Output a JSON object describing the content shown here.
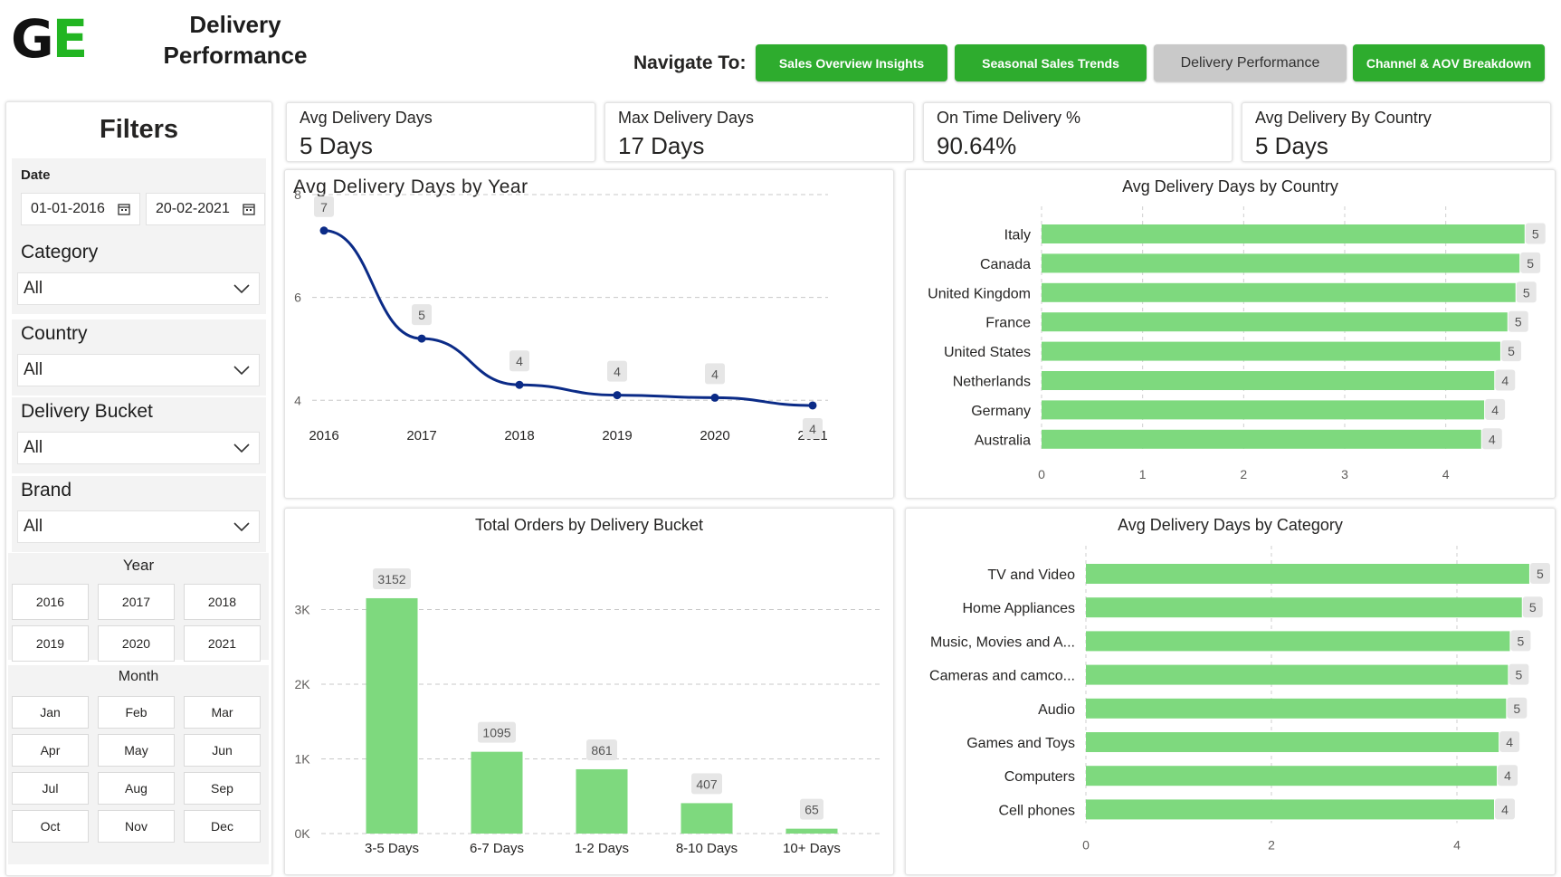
{
  "header": {
    "logo_g": "G",
    "logo_e": "E",
    "title_line1": "Delivery",
    "title_line2": "Performance",
    "navigate_label": "Navigate To:",
    "nav": [
      {
        "label": "Sales Overview Insights",
        "active": false
      },
      {
        "label": "Seasonal Sales Trends",
        "active": false
      },
      {
        "label": "Delivery Performance",
        "active": true
      },
      {
        "label": "Channel & AOV Breakdown",
        "active": false
      }
    ]
  },
  "filters": {
    "title": "Filters",
    "date_label": "Date",
    "date_from": "01-01-2016",
    "date_to": "20-02-2021",
    "category_label": "Category",
    "category_value": "All",
    "country_label": "Country",
    "country_value": "All",
    "bucket_label": "Delivery Bucket",
    "bucket_value": "All",
    "brand_label": "Brand",
    "brand_value": "All",
    "year_label": "Year",
    "years": [
      "2016",
      "2017",
      "2018",
      "2019",
      "2020",
      "2021"
    ],
    "month_label": "Month",
    "months": [
      "Jan",
      "Feb",
      "Mar",
      "Apr",
      "May",
      "Jun",
      "Jul",
      "Aug",
      "Sep",
      "Oct",
      "Nov",
      "Dec"
    ]
  },
  "kpis": [
    {
      "label": "Avg Delivery Days",
      "value": "5 Days"
    },
    {
      "label": "Max Delivery Days",
      "value": "17 Days"
    },
    {
      "label": "On Time Delivery %",
      "value": "90.64%"
    },
    {
      "label": "Avg Delivery By Country",
      "value": "5 Days"
    }
  ],
  "colors": {
    "bar": "#7ed97e",
    "line": "#0b2b87",
    "nav_green": "#2eac2e",
    "nav_active": "#c9c9c9"
  },
  "chart_data": [
    {
      "type": "line",
      "title": "Avg Delivery Days by Year",
      "x": [
        "2016",
        "2017",
        "2018",
        "2019",
        "2020",
        "2021"
      ],
      "values": [
        7.3,
        5.2,
        4.3,
        4.1,
        4.05,
        3.9
      ],
      "data_labels": [
        "7",
        "5",
        "4",
        "4",
        "4",
        "4"
      ],
      "yticks": [
        "4",
        "6",
        "8"
      ],
      "ylim": [
        3.6,
        8
      ],
      "grid": true
    },
    {
      "type": "bar",
      "orientation": "horizontal",
      "title": "Avg Delivery Days by Country",
      "categories": [
        "Italy",
        "Canada",
        "United Kingdom",
        "France",
        "United States",
        "Netherlands",
        "Germany",
        "Australia"
      ],
      "values": [
        4.78,
        4.73,
        4.69,
        4.61,
        4.54,
        4.48,
        4.38,
        4.35
      ],
      "data_labels": [
        "5",
        "5",
        "5",
        "5",
        "5",
        "4",
        "4",
        "4"
      ],
      "xticks": [
        "0",
        "1",
        "2",
        "3",
        "4"
      ],
      "xlim": [
        0,
        4.8
      ],
      "grid": true
    },
    {
      "type": "bar",
      "title": "Total Orders by Delivery Bucket",
      "categories": [
        "3-5 Days",
        "6-7 Days",
        "1-2 Days",
        "8-10 Days",
        "10+ Days"
      ],
      "values": [
        3152,
        1095,
        861,
        407,
        65
      ],
      "data_labels": [
        "3152",
        "1095",
        "861",
        "407",
        "65"
      ],
      "yticks": [
        "0K",
        "1K",
        "2K",
        "3K"
      ],
      "ylim": [
        0,
        3600
      ],
      "grid": true
    },
    {
      "type": "bar",
      "orientation": "horizontal",
      "title": "Avg Delivery Days by Category",
      "categories": [
        "TV and Video",
        "Home Appliances",
        "Music, Movies and A...",
        "Cameras and camco...",
        "Audio",
        "Games and Toys",
        "Computers",
        "Cell phones"
      ],
      "values": [
        4.78,
        4.7,
        4.57,
        4.55,
        4.53,
        4.45,
        4.43,
        4.4
      ],
      "data_labels": [
        "5",
        "5",
        "5",
        "5",
        "5",
        "4",
        "4",
        "4"
      ],
      "xticks": [
        "0",
        "2",
        "4"
      ],
      "xlim": [
        0,
        4.8
      ],
      "grid": true
    }
  ]
}
